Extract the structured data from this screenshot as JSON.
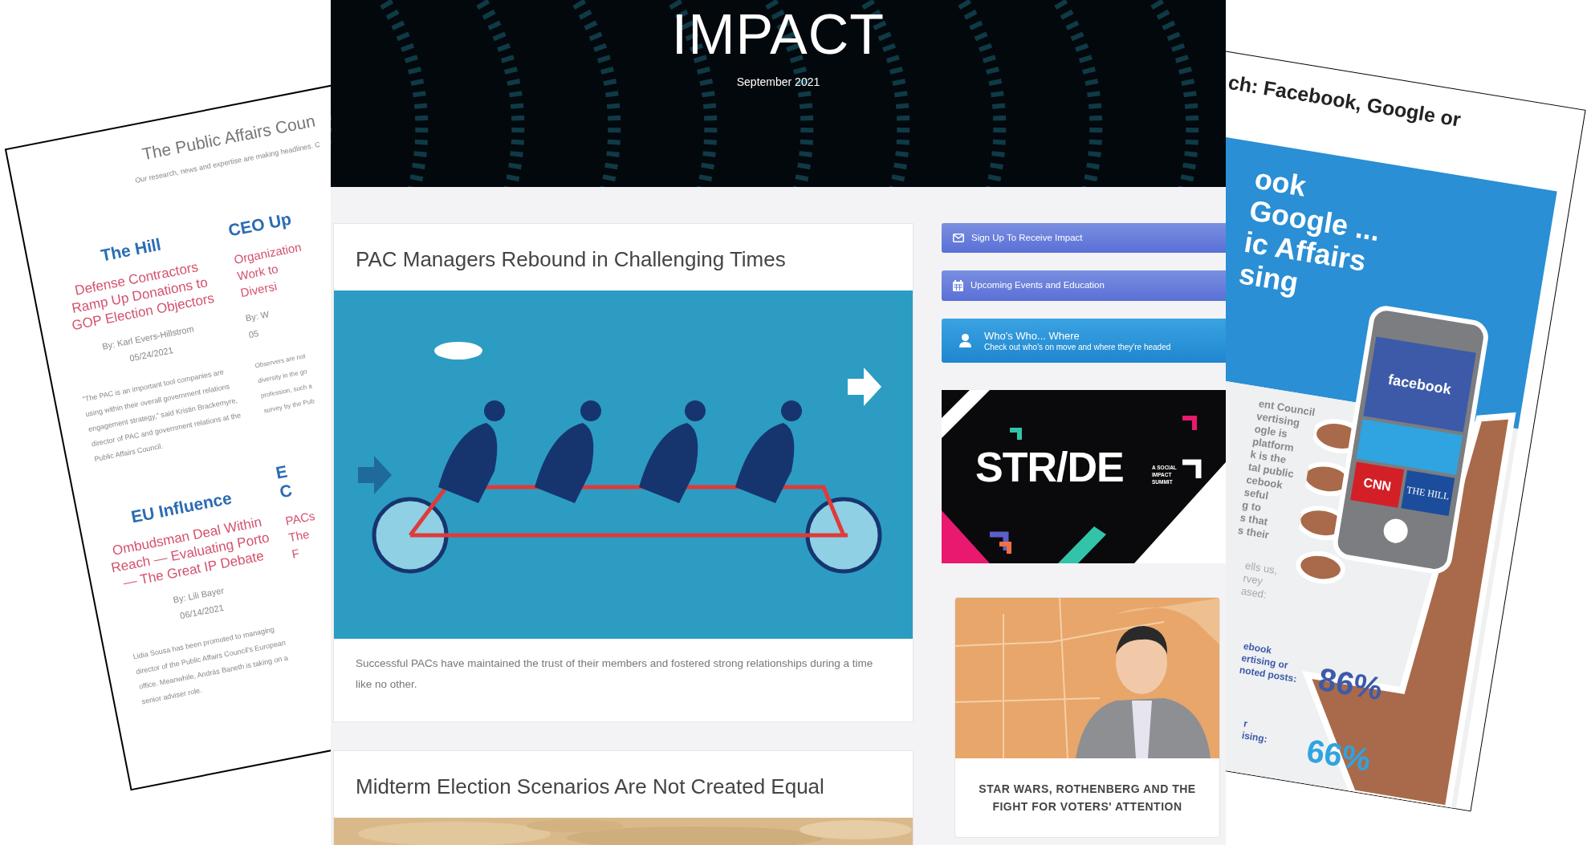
{
  "left_document": {
    "title": "The Public Affairs Coun",
    "subtitle": "Our research, news and expertise are making headlines. C",
    "columns": [
      [
        {
          "section_lines": [
            "The Hill"
          ],
          "headline_lines": [
            "Defense Contractors",
            "Ramp Up Donations to",
            "GOP Election Objectors"
          ],
          "byline": "By: Karl Evers-Hillstrom",
          "date": "05/24/2021",
          "summary_lines": [
            "“The PAC is an important tool companies are",
            "using within their overall government relations",
            "engagement strategy,” said Kristin Brackemyre,",
            "director of PAC and government relations at the",
            "Public Affairs Council."
          ]
        },
        {
          "section_lines": [
            "EU Influence"
          ],
          "headline_lines": [
            "Ombudsman Deal Within",
            "Reach — Evaluating Porto",
            "— The Great IP Debate"
          ],
          "byline": "By: Lili Bayer",
          "date": "06/14/2021",
          "summary_lines": [
            "Lidia Sousa has been promoted to managing",
            "director of the Public Affairs Council's European",
            "office. Meanwhile, András Baneth is taking on a",
            "senior adviser role."
          ]
        }
      ],
      [
        {
          "section_lines": [
            "CEO Up"
          ],
          "headline_lines": [
            "Organization",
            "Work to",
            "Diversi"
          ],
          "byline": "By: W",
          "date": "05",
          "summary_lines": [
            "Observers are not",
            "diversity in the go",
            "profession, such a",
            "survey by the Pub"
          ]
        },
        {
          "section_lines": [
            "E",
            "C"
          ],
          "headline_lines": [
            "PACs",
            "The",
            "F"
          ]
        }
      ]
    ]
  },
  "header": {
    "title": "IMPACT",
    "date": "September 2021"
  },
  "articles": [
    {
      "title": "PAC Managers Rebound in Challenging Times",
      "summary": "Successful PACs have maintained the trust of their members and fostered strong relationships during a time like no other."
    },
    {
      "title": "Midterm Election Scenarios Are Not Created Equal"
    }
  ],
  "sidebar": {
    "buttons": [
      {
        "kind": "mail",
        "label": "Sign Up To Receive Impact"
      },
      {
        "kind": "calendar",
        "label": "Upcoming Events and Education"
      },
      {
        "kind": "person",
        "label": "Who's Who... Where",
        "sublabel": "Check out who's on move and where they're headed"
      }
    ],
    "banner": {
      "wordmark": "STR/DE",
      "tagline_lines": [
        "A SOCIAL",
        "IMPACT",
        "SUMMIT"
      ]
    },
    "feature_card": {
      "title_lines": [
        "STAR WARS, ROTHENBERG AND THE",
        "FIGHT FOR VOTERS' ATTENTION"
      ]
    }
  },
  "right_document": {
    "title": "ch: Facebook, Google or",
    "heading_lines": [
      "ook",
      "Google ...",
      "ic Affairs",
      "sing"
    ],
    "phone_tiles": [
      {
        "label": "facebook"
      },
      {
        "label": "CNN"
      },
      {
        "label": "THE HILL"
      }
    ],
    "body_lines": [
      "ent Council",
      "vertising",
      "ogle is",
      "platform",
      "k is the",
      "tal public",
      "cebook",
      "seful",
      "g to",
      "s that",
      "s their"
    ],
    "note_lines": [
      "ells us,",
      "rvey",
      "ased:"
    ],
    "stats": [
      {
        "label_lines": [
          "ebook",
          "ertising or",
          "noted posts:"
        ],
        "value": "86%"
      },
      {
        "label_lines": [
          "r",
          "ising:"
        ],
        "value": "66%"
      }
    ]
  }
}
